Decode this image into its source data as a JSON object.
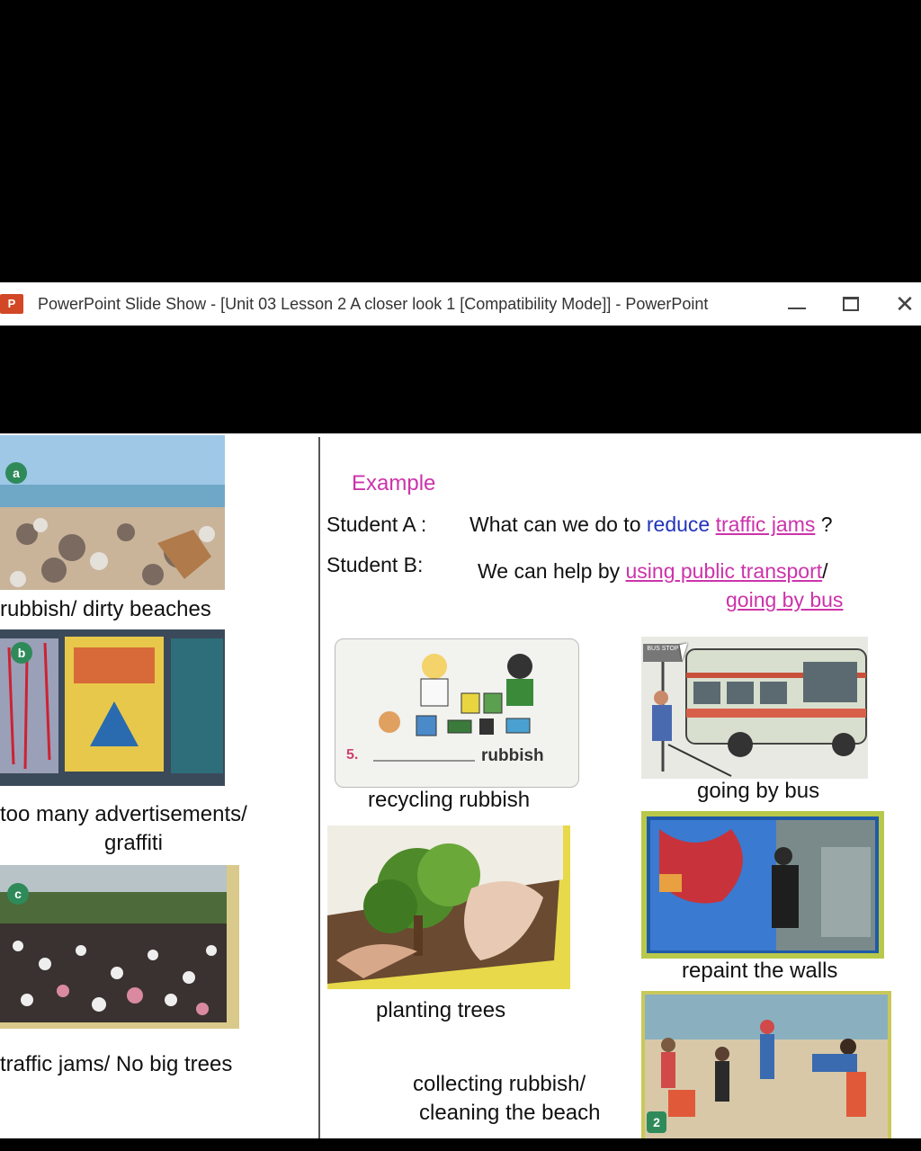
{
  "window": {
    "app_icon_text": "P",
    "title": "PowerPoint Slide Show - [Unit 03 Lesson 2 A closer look 1 [Compatibility Mode]] - PowerPoint",
    "minimize_label": "—",
    "close_label": "✕"
  },
  "slide": {
    "left_items": [
      {
        "badge": "a",
        "label": "rubbish/ dirty beaches"
      },
      {
        "badge": "b",
        "label_line1": "too many advertisements/",
        "label_line2": "graffiti"
      },
      {
        "badge": "c",
        "label": "traffic jams/ No big trees"
      }
    ],
    "example": {
      "heading": "Example",
      "student_a": "Student A :",
      "q_prefix": "What can we do to ",
      "q_verb": "reduce",
      "q_object": "traffic jams",
      "q_end": " ?",
      "student_b": "Student B:",
      "a_prefix": "We can help by ",
      "a_option1": "using public transport",
      "a_slash": "/",
      "a_option2": "going by bus"
    },
    "recycle_card": {
      "number": "5.",
      "word": "rubbish"
    },
    "bus_stop_sign": "BUS STOP",
    "captions": {
      "recycling": "recycling rubbish",
      "bus": "going by bus",
      "planting": "planting trees",
      "repaint": "repaint  the walls",
      "collecting_line1": "collecting rubbish/",
      "collecting_line2": "cleaning the beach"
    },
    "beach_photo_number": "2"
  },
  "colors": {
    "accent_pink": "#cc33aa",
    "accent_blue": "#2233bb",
    "ppt_orange": "#d24726"
  }
}
